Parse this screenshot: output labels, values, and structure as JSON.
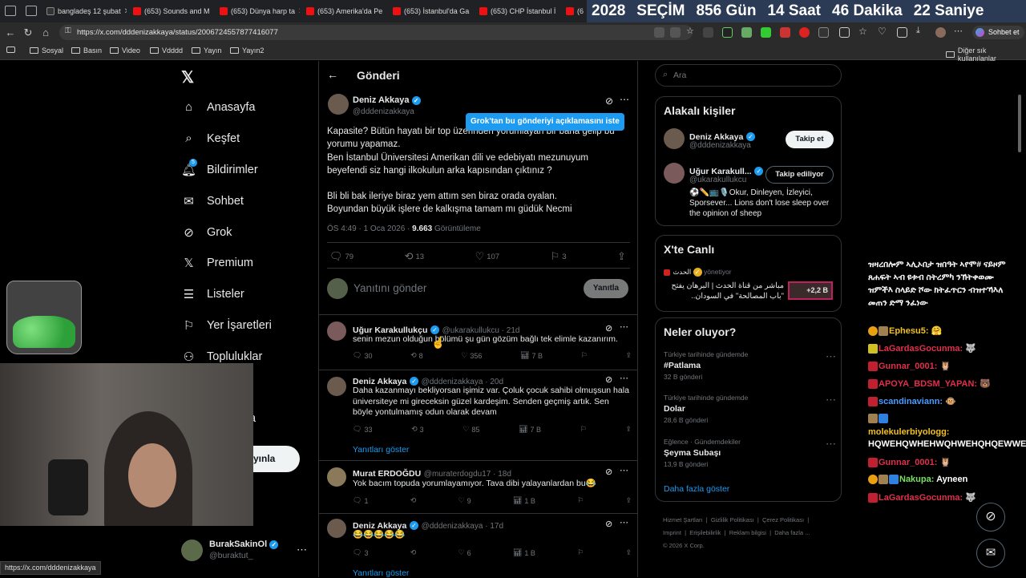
{
  "tabs": [
    {
      "label": "bangladeş 12 şubat",
      "icon": "bookmark-icon"
    },
    {
      "label": "(653) Sounds and M",
      "icon": "youtube-icon"
    },
    {
      "label": "(653) Dünya harp ta",
      "icon": "youtube-icon"
    },
    {
      "label": "(653) Amerika'da Pe",
      "icon": "youtube-icon"
    },
    {
      "label": "(653) İstanbul'da Ga",
      "icon": "youtube-icon"
    },
    {
      "label": "(653) CHP İstanbul İ",
      "icon": "youtube-icon"
    },
    {
      "label": "(6",
      "icon": "youtube-icon"
    }
  ],
  "countdown": {
    "year": "2028",
    "word": "SEÇİM",
    "days": "856",
    "days_label": "Gün",
    "hours": "14",
    "hours_label": "Saat",
    "minutes": "46",
    "minutes_label": "Dakika",
    "seconds": "22",
    "seconds_label": "Saniye"
  },
  "browser": {
    "url": "https://x.com/dddenizakkaya/status/2006724557877416077",
    "chat_label": "Sohbet et",
    "status_url": "https://x.com/dddenizakkaya"
  },
  "bookmarks": [
    "Sosyal",
    "Basın",
    "Video",
    "Vdddd",
    "Yayın",
    "Yayın2"
  ],
  "bookmarks_other": "Diğer sık kullanılanlar",
  "nav": {
    "items": [
      "Anasayfa",
      "Keşfet",
      "Bildirimler",
      "Sohbet",
      "Grok",
      "Premium",
      "Listeler",
      "Yer İşaretleri",
      "Topluluklar",
      "a"
    ],
    "notif_count": "5",
    "post_button": "yınla",
    "account": {
      "name": "BurakSakinOl",
      "handle": "@buraktut_"
    }
  },
  "post": {
    "header": "Gönderi",
    "author": "Deniz Akkaya",
    "handle": "@dddenizakkaya",
    "grok_tooltip": "Grok'tan bu gönderiyi açıklamasını iste",
    "lines": [
      "Kapasite? Bütün hayatı bir top üzerinden yorumlayan bir bana gelip bu",
      "yorumu yapamaz.",
      "Ben İstanbul Üniversitesi Amerikan dili ve edebiyatı mezunuyum",
      "beyefendi siz hangi ilkokulun arka kapısından çıktınız ?",
      "",
      "Bli bli bak ileriye biraz yem attım sen biraz orada oyalan.",
      "Boyundan büyük işlere de kalkışma tamam mı güdük Necmi"
    ],
    "time": "ÖS 4:49 · 1 Oca 2026 · ",
    "views": "9.663",
    "views_label": "Görüntüleme",
    "replies": "79",
    "reposts": "13",
    "likes": "107",
    "bookmarks": "3",
    "reply_placeholder": "Yanıtını gönder",
    "reply_button": "Yanıtla"
  },
  "replies": [
    {
      "name": "Uğur Karakullukçu",
      "handle": "@ukarakullukcu · 21d",
      "text": "senin mezun olduğun bölümü şu gün gözüm bağlı tek elimle kazanırım.",
      "replies": "30",
      "reposts": "8",
      "likes": "356",
      "views": "7 B"
    },
    {
      "name": "Deniz Akkaya",
      "handle": "@dddenizakkaya · 20d",
      "text": "Daha kazanmayı bekliyorsan işimiz var. Çoluk çocuk sahibi olmuşsun hala üniversiteye mi gireceksin güzel kardeşim. Senden geçmiş artık. Sen böyle yontulmamış odun olarak devam",
      "replies": "33",
      "reposts": "3",
      "likes": "85",
      "views": "7 B",
      "show_replies": "Yanıtları göster"
    },
    {
      "name": "Murat ERDOĞDU",
      "handle": "@muraterdogdu17 · 18d",
      "text": "Yok bacım topuda yorumlayamıyor. Tava dibi yalayanlardan bu😂",
      "replies": "1",
      "reposts": "",
      "likes": "9",
      "views": "1 B"
    },
    {
      "name": "Deniz Akkaya",
      "handle": "@dddenizakkaya · 17d",
      "text": "😂😂😂😂😂",
      "replies": "3",
      "reposts": "",
      "likes": "6",
      "views": "1 B",
      "show_replies": "Yanıtları göster"
    }
  ],
  "right": {
    "search_placeholder": "Ara",
    "related_title": "Alakalı kişiler",
    "people": [
      {
        "name": "Deniz Akkaya",
        "handle": "@dddenizakkaya",
        "button": "Takip et"
      },
      {
        "name": "Uğur Karakull...",
        "handle": "@ukarakullukcu",
        "button": "Takip ediliyor",
        "bio": "⚽✏️📺🎙️Okur, Dinleyen, İzleyici, Sporsever... Lions don't lose sleep over the opinion of sheep"
      }
    ],
    "live_title": "X'te Canlı",
    "live": {
      "source": "الحدث",
      "host": "yönetiyor",
      "text": "مباشر من قناة الحدث | البرهان يفتح \"باب المصالحة\" في السودان..",
      "count": "+2,2 B"
    },
    "trends_title": "Neler oluyor?",
    "trends": [
      {
        "context": "Türkiye tarihinde gündemde",
        "name": "#Patlama",
        "count": "32 B gönderi"
      },
      {
        "context": "Türkiye tarihinde gündemde",
        "name": "Dolar",
        "count": "28,6 B gönderi"
      },
      {
        "context": "Eğlence · Gündemdekiler",
        "name": "Şeyma Subaşı",
        "count": "13,9 B gönderi"
      }
    ],
    "more": "Daha fazla göster",
    "footer": [
      "Hizmet Şartları",
      "Gizlilik Politikası",
      "Çerez Politikası",
      "Imprint",
      "Erişilebilirlik",
      "Reklam bilgisi",
      "Daha fazla ...",
      "© 2026 X Corp."
    ]
  },
  "chat": [
    {
      "user": "",
      "msg": "ዝዛረበሎም ኣሊኦበታ ዝበዓት ኣየሞ# ናይዞም ጸሐፍት ኣብ ዩቱብ ስትረምካ ንኽትቀወሙ ዝምችእ ስላይድ ሾው ክትፈጥርን ብዝተኻእለ መጠን ድማ ንፈነው",
      "color": "#ffffff"
    },
    {
      "user": "Ephesu5:",
      "msg": "🤗",
      "color": "#f0c020"
    },
    {
      "user": "LaGardasGocunma:",
      "msg": "🐺",
      "color": "#e0304a"
    },
    {
      "user": "Gunnar_0001:",
      "msg": "🦉",
      "color": "#e0304a"
    },
    {
      "user": "APOYA_BDSM_YAPAN:",
      "msg": "🐻",
      "color": "#e0304a"
    },
    {
      "user": "scandinaviann:",
      "msg": "🐵",
      "color": "#4a9cff"
    },
    {
      "user": "molekulerbiyologg:",
      "msg": "HQWEHQWHEHWQHWEHQHQEWWEQ",
      "color": "#f0c020"
    },
    {
      "user": "Gunnar_0001:",
      "msg": "🦉",
      "color": "#e0304a"
    },
    {
      "user": "Nakupa:",
      "msg": "Ayneen",
      "color": "#7ae060"
    },
    {
      "user": "LaGardasGocunma:",
      "msg": "🐺",
      "color": "#e0304a"
    }
  ]
}
